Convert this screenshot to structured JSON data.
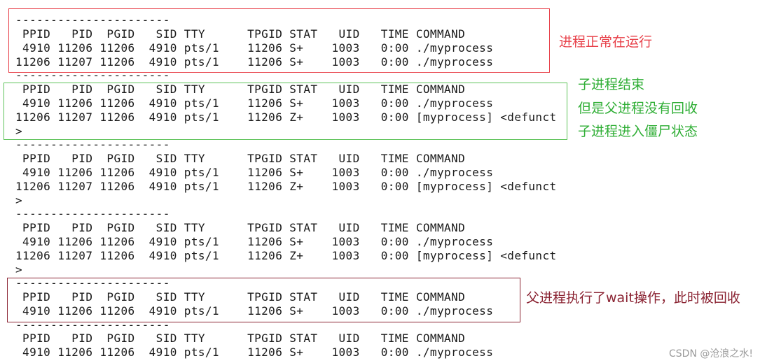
{
  "terminal": {
    "lines": [
      "----------------------",
      " PPID   PID  PGID   SID TTY      TPGID STAT   UID   TIME COMMAND",
      " 4910 11206 11206  4910 pts/1    11206 S+    1003   0:00 ./myprocess",
      "11206 11207 11206  4910 pts/1    11206 S+    1003   0:00 ./myprocess",
      "----------------------",
      " PPID   PID  PGID   SID TTY      TPGID STAT   UID   TIME COMMAND",
      " 4910 11206 11206  4910 pts/1    11206 S+    1003   0:00 ./myprocess",
      "11206 11207 11206  4910 pts/1    11206 Z+    1003   0:00 [myprocess] <defunct",
      ">",
      "----------------------",
      " PPID   PID  PGID   SID TTY      TPGID STAT   UID   TIME COMMAND",
      " 4910 11206 11206  4910 pts/1    11206 S+    1003   0:00 ./myprocess",
      "11206 11207 11206  4910 pts/1    11206 Z+    1003   0:00 [myprocess] <defunct",
      ">",
      "----------------------",
      " PPID   PID  PGID   SID TTY      TPGID STAT   UID   TIME COMMAND",
      " 4910 11206 11206  4910 pts/1    11206 S+    1003   0:00 ./myprocess",
      "11206 11207 11206  4910 pts/1    11206 Z+    1003   0:00 [myprocess] <defunct",
      ">",
      "----------------------",
      " PPID   PID  PGID   SID TTY      TPGID STAT   UID   TIME COMMAND",
      " 4910 11206 11206  4910 pts/1    11206 S+    1003   0:00 ./myprocess",
      "----------------------",
      " PPID   PID  PGID   SID TTY      TPGID STAT   UID   TIME COMMAND",
      " 4910 11206 11206  4910 pts/1    11206 S+    1003   0:00 ./myprocess"
    ]
  },
  "annotations": {
    "running": "进程正常在运行",
    "zombie_1": "子进程结束",
    "zombie_2": "但是父进程没有回收",
    "zombie_3": "子进程进入僵尸状态",
    "reaped": "父进程执行了wait操作，此时被回收"
  },
  "colors": {
    "red": "#e8414a",
    "green": "#5ec35a",
    "maroon": "#8b2433"
  },
  "watermark": "CSDN @沧浪之水!"
}
